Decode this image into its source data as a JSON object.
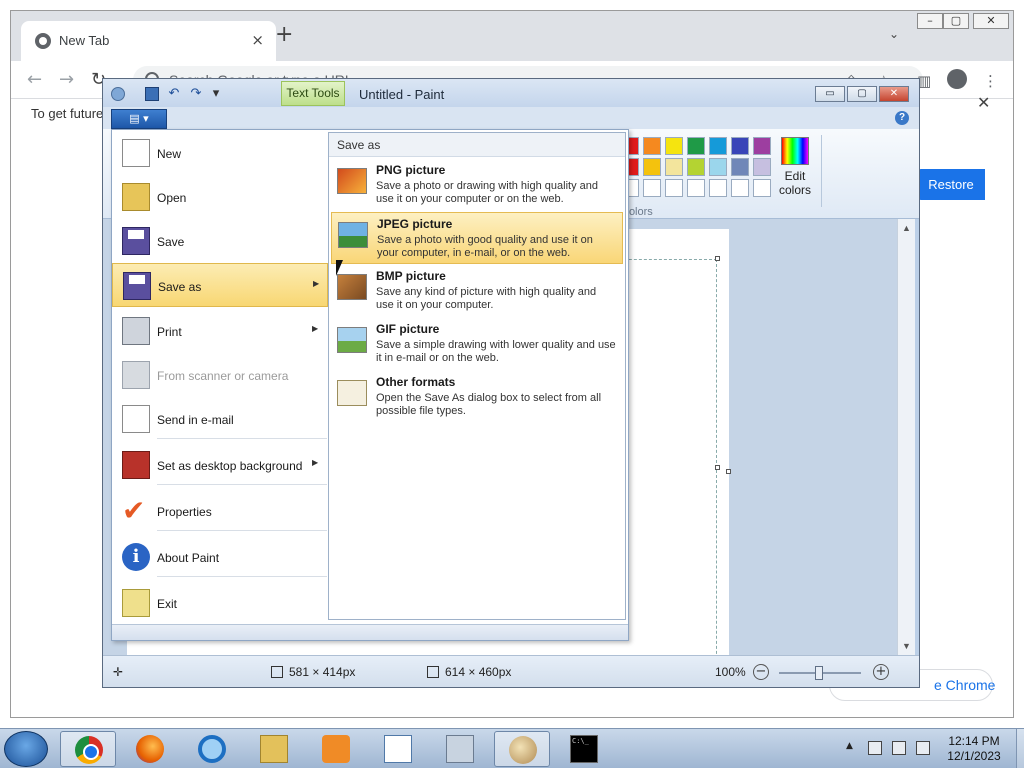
{
  "browser": {
    "tab_title": "New Tab",
    "tab_close": "×",
    "new_tab": "+",
    "tab_search": "⌄",
    "window_controls": [
      "–",
      "▢",
      "✕"
    ],
    "nav": {
      "back": "←",
      "forward": "→",
      "reload": "↻"
    },
    "omnibox_placeholder": "Search Google or type a URL",
    "toolbar_icons": {
      "share": "⇪",
      "bookmark": "☆",
      "sidepanel": "▥",
      "menu": "⋮"
    },
    "infobar_text": "To get future",
    "infobar_close": "✕",
    "restore_label": "Restore",
    "chrome_pill_label": "e Chrome"
  },
  "paint": {
    "title": "Untitled - Paint",
    "contextual_tab": "Text Tools",
    "menu_button": "▤ ▾",
    "window_controls": [
      "▭",
      "▢",
      "✕"
    ],
    "help": "?",
    "colors_label": "Colors",
    "edit_colors_label": "Edit colors",
    "palette": [
      [
        "#e01b1b",
        "#f5891f",
        "#f5e40f",
        "#1f9a47",
        "#159ad9",
        "#3945b8",
        "#9d3ea0"
      ],
      [
        "#e01b1b",
        "#f4c20d",
        "#f3e59d",
        "#b4d332",
        "#9bd6ec",
        "#7087b8",
        "#c6bfe0"
      ],
      [
        "#ffffff",
        "#ffffff",
        "#ffffff",
        "#ffffff",
        "#ffffff",
        "#ffffff",
        "#ffffff"
      ]
    ],
    "status": {
      "cursor_pos": "",
      "selection_size": "581 × 414px",
      "image_size": "614 × 460px",
      "zoom": "100%",
      "zoom_minus": "−",
      "zoom_plus": "+",
      "zoom_level": 1.0
    }
  },
  "file_menu": {
    "items": [
      {
        "label": "New",
        "icon": "new-document-icon",
        "arrow": ""
      },
      {
        "label": "Open",
        "icon": "open-folder-icon",
        "arrow": ""
      },
      {
        "label": "Save",
        "icon": "save-floppy-icon",
        "arrow": ""
      },
      {
        "label": "Save as",
        "icon": "save-as-icon",
        "arrow": "▶"
      },
      {
        "label": "Print",
        "icon": "printer-icon",
        "arrow": "▶"
      },
      {
        "label": "From scanner or camera",
        "icon": "scanner-icon",
        "arrow": ""
      },
      {
        "label": "Send in e-mail",
        "icon": "email-icon",
        "arrow": ""
      },
      {
        "label": "Set as desktop background",
        "icon": "desktop-background-icon",
        "arrow": "▶"
      },
      {
        "label": "Properties",
        "icon": "properties-check-icon",
        "arrow": ""
      },
      {
        "label": "About Paint",
        "icon": "info-icon",
        "arrow": ""
      },
      {
        "label": "Exit",
        "icon": "exit-icon",
        "arrow": ""
      }
    ]
  },
  "save_as": {
    "title": "Save as",
    "formats": [
      {
        "name": "PNG picture",
        "desc": "Save a photo or drawing with high quality and use it on your computer or on the web.",
        "icon": "png-icon"
      },
      {
        "name": "JPEG picture",
        "desc": "Save a photo with good quality and use it on your computer, in e-mail, or on the web.",
        "icon": "jpeg-icon"
      },
      {
        "name": "BMP picture",
        "desc": "Save any kind of picture with high quality and use it on your computer.",
        "icon": "bmp-icon"
      },
      {
        "name": "GIF picture",
        "desc": "Save a simple drawing with lower quality and use it in e-mail or on the web.",
        "icon": "gif-icon"
      },
      {
        "name": "Other formats",
        "desc": "Open the Save As dialog box to select from all possible file types.",
        "icon": "other-formats-icon"
      }
    ]
  },
  "taskbar": {
    "apps": [
      "chrome-icon",
      "firefox-icon",
      "internet-explorer-icon",
      "file-explorer-icon",
      "media-player-icon",
      "wordpad-icon",
      "calculator-icon",
      "paint-icon",
      "command-prompt-icon"
    ],
    "cmd_glyph": "C:\\_",
    "tray_arrow": "▲",
    "time": "12:14 PM",
    "date": "12/1/2023"
  }
}
